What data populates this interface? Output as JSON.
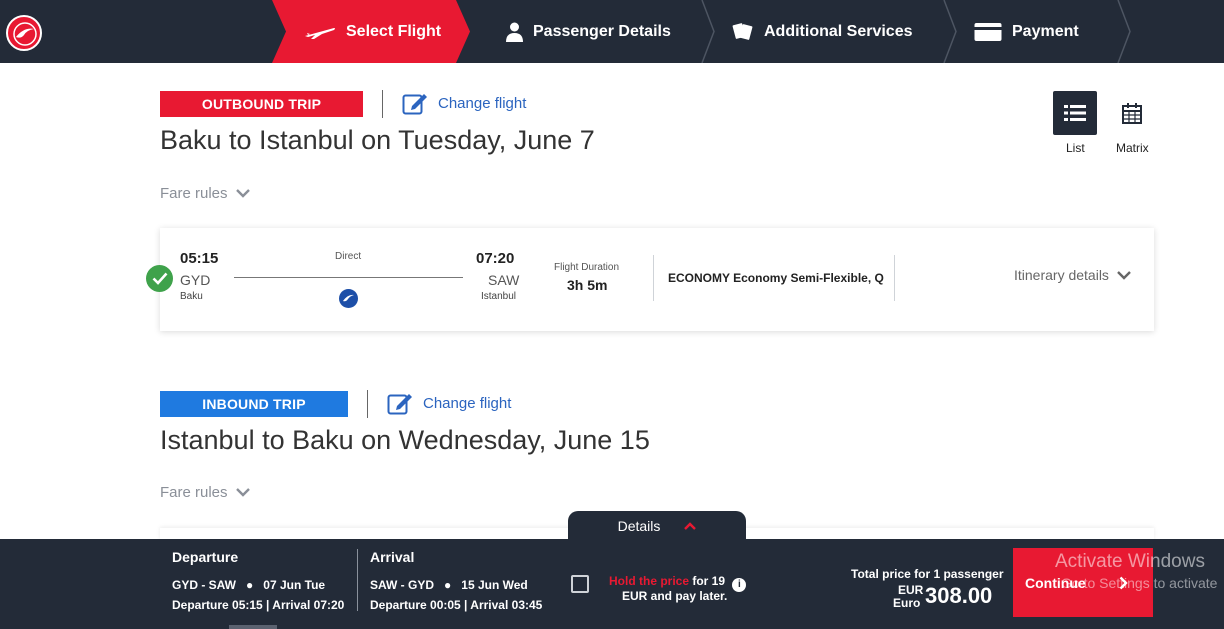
{
  "nav": {
    "steps": [
      {
        "label": "Select Flight",
        "icon": "plane-icon",
        "active": true
      },
      {
        "label": "Passenger Details",
        "icon": "person-icon",
        "active": false
      },
      {
        "label": "Additional Services",
        "icon": "tags-icon",
        "active": false
      },
      {
        "label": "Payment",
        "icon": "card-icon",
        "active": false
      }
    ]
  },
  "colors": {
    "brand_red": "#e81932",
    "dark": "#232b38",
    "inbound_blue": "#1f7ae0",
    "link_blue": "#2b64bf",
    "check_green": "#3fa24b"
  },
  "outbound": {
    "badge": "OUTBOUND TRIP",
    "change": "Change flight",
    "title": "Baku to Istanbul on Tuesday, June 7",
    "fare_rules": "Fare rules",
    "flight": {
      "dep_time": "05:15",
      "dep_code": "GYD",
      "dep_city": "Baku",
      "stops": "Direct",
      "arr_time": "07:20",
      "arr_code": "SAW",
      "arr_city": "Istanbul",
      "duration_label": "Flight Duration",
      "duration": "3h 5m",
      "cabin": "ECONOMY Economy Semi-Flexible, Q",
      "itinerary": "Itinerary details"
    }
  },
  "view_toggle": {
    "list": "List",
    "matrix": "Matrix"
  },
  "inbound": {
    "badge": "INBOUND TRIP",
    "change": "Change flight",
    "title": "Istanbul to Baku on Wednesday, June 15",
    "fare_rules": "Fare rules"
  },
  "summary": {
    "details_tab": "Details",
    "departure": {
      "heading": "Departure",
      "route": "GYD - SAW",
      "date": "07 Jun Tue",
      "times": "Departure 05:15 | Arrival 07:20"
    },
    "arrival": {
      "heading": "Arrival",
      "route": "SAW - GYD",
      "date": "15 Jun Wed",
      "times": "Departure 00:05 | Arrival 03:45"
    },
    "hold": {
      "red": "Hold the price",
      "rest1": " for 19",
      "rest2": "EUR and pay later."
    },
    "total_label": "Total price for 1 passenger",
    "currency_code": "EUR",
    "currency_name": "Euro",
    "price": "308.00",
    "continue": "Continue"
  },
  "watermark": {
    "line1": "Activate Windows",
    "line2": "Go to Settings to activate"
  }
}
